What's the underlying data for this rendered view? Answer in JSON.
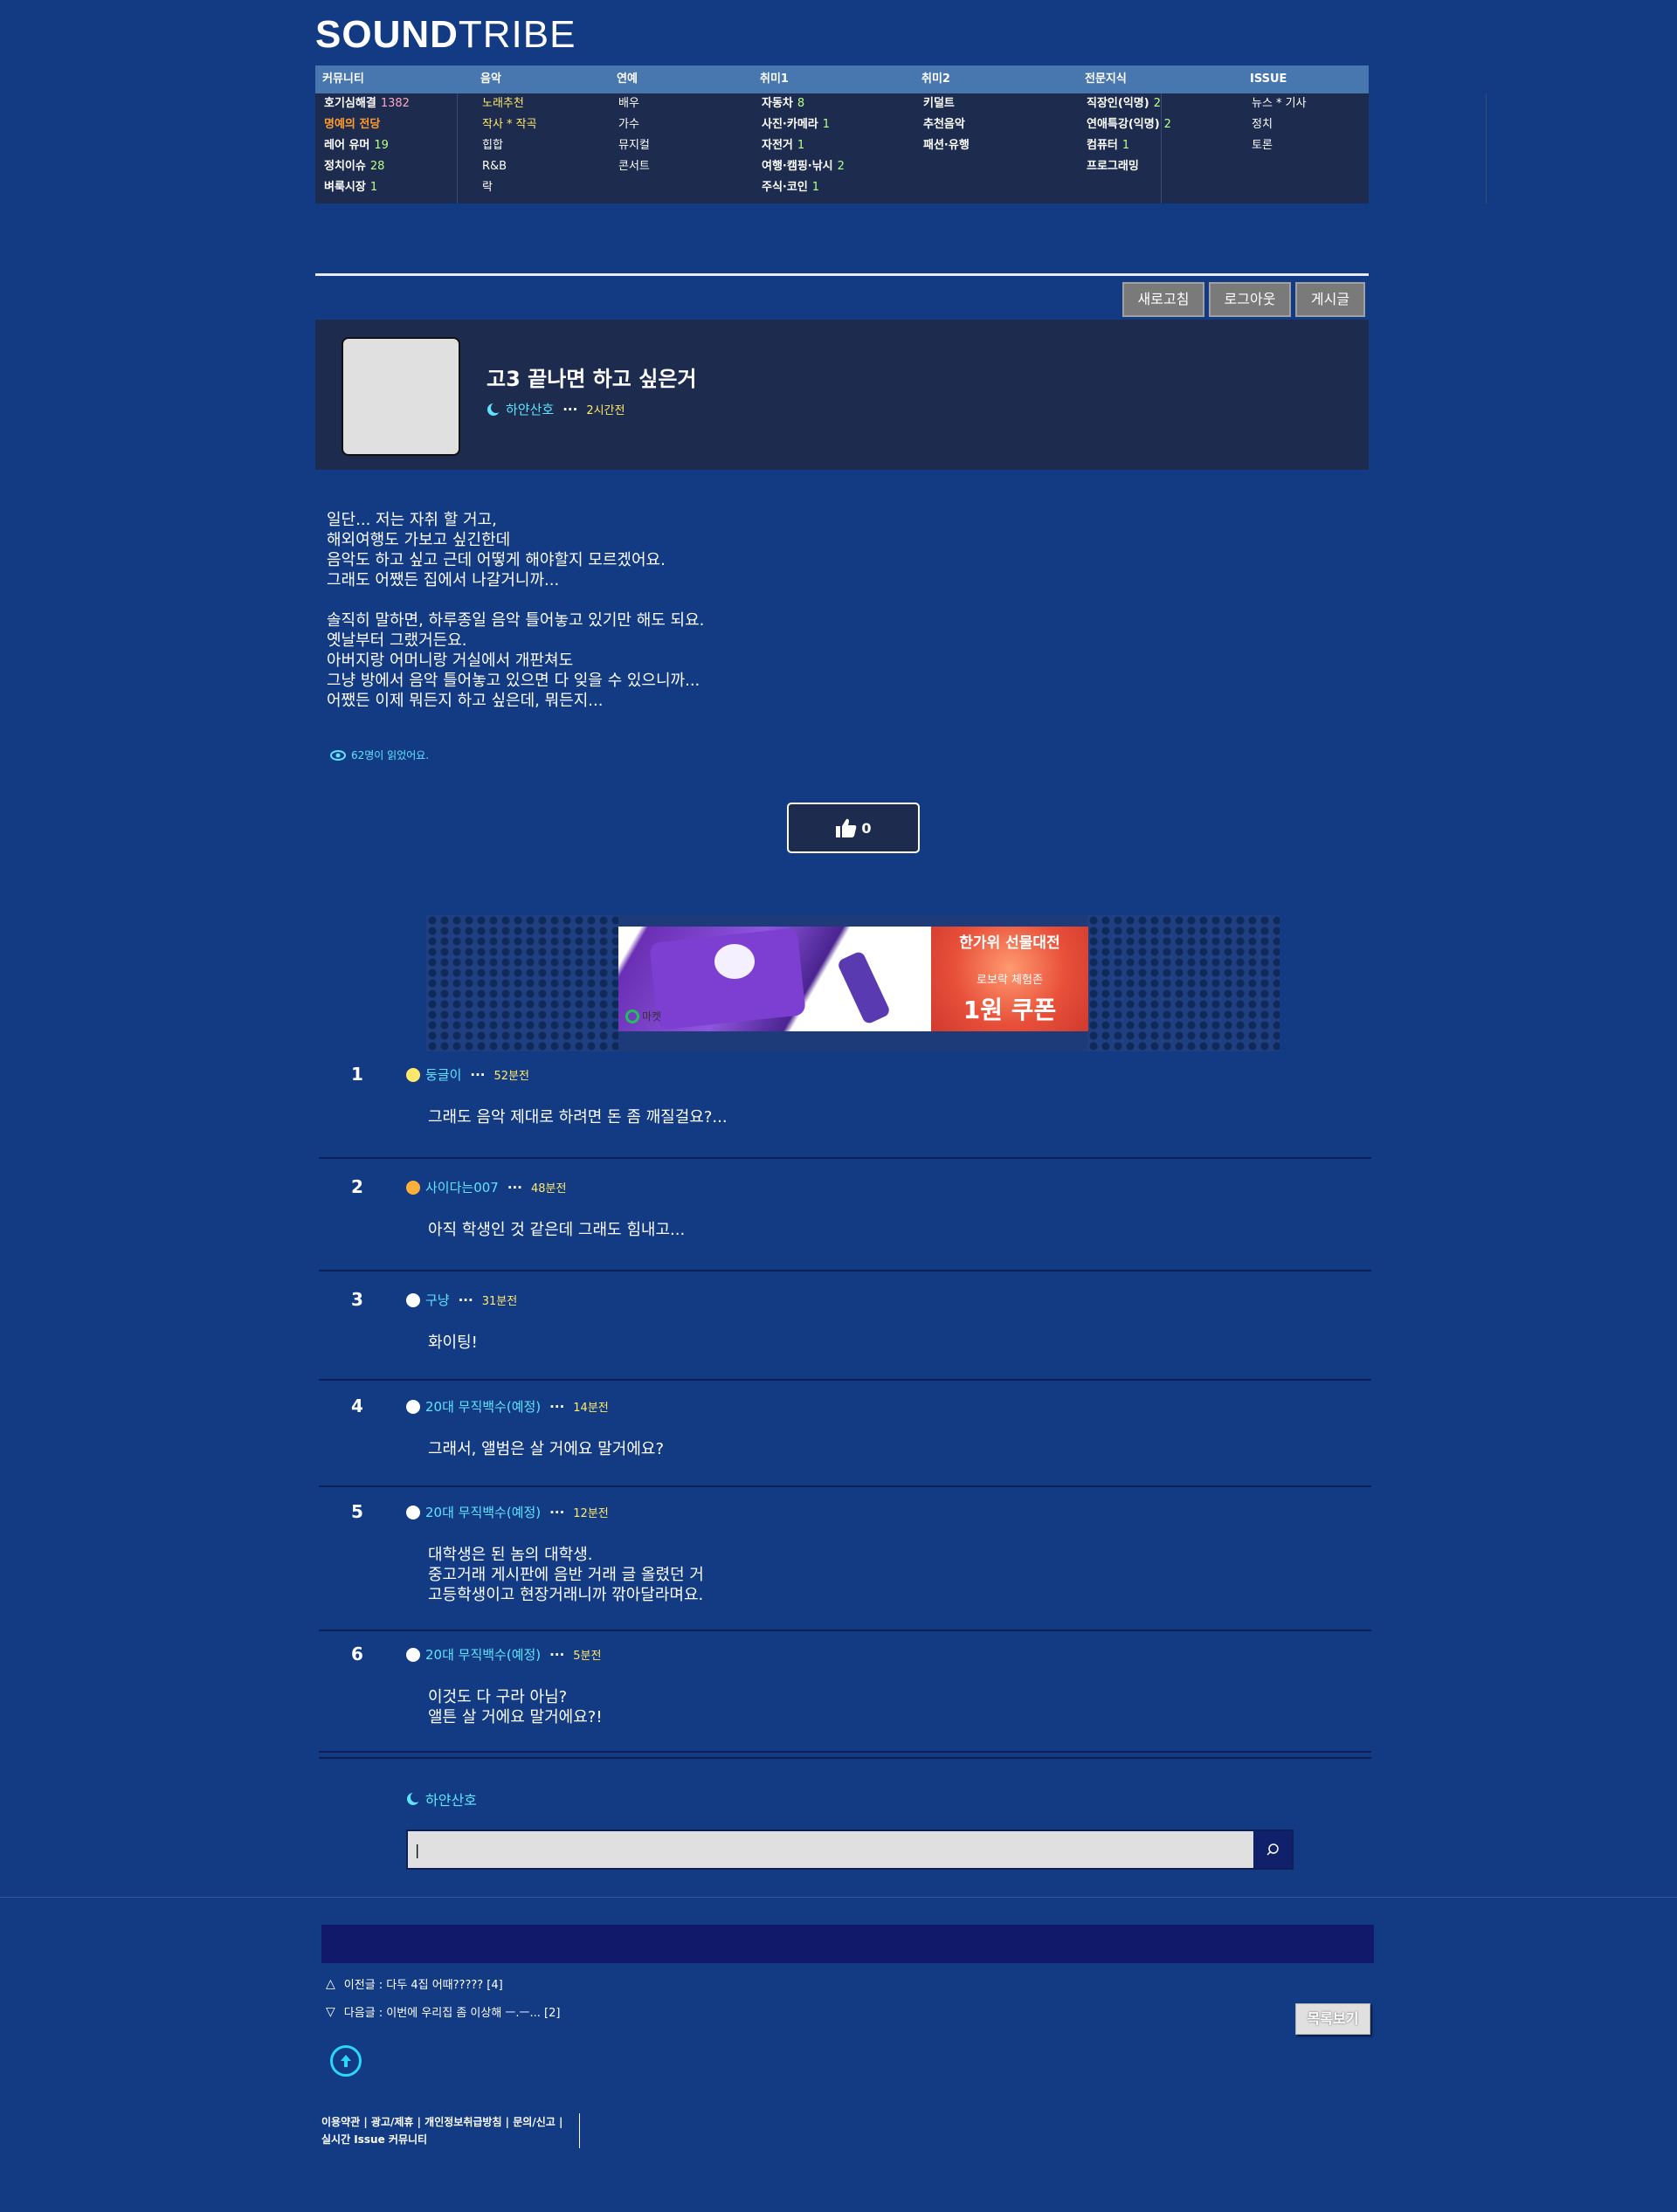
{
  "brand": {
    "bold": "SOUND",
    "light": "TRIBE"
  },
  "nav": {
    "columns": [
      {
        "title": "커뮤니티",
        "items": [
          {
            "label": "호기심해결",
            "count": "1382",
            "count_color": "pink"
          },
          {
            "label": "명예의 전당",
            "color": "orange"
          },
          {
            "label": "레어 유머",
            "count": "19"
          },
          {
            "label": "정치이슈",
            "count": "28"
          },
          {
            "label": "벼룩시장",
            "count": "1"
          }
        ]
      },
      {
        "title": "음악",
        "items": [
          {
            "label": "노래추천",
            "color": "yellow"
          },
          {
            "label": "작사 * 작곡",
            "color": "yellow"
          },
          {
            "label": "힙합"
          },
          {
            "label": "R&B"
          },
          {
            "label": "락"
          }
        ]
      },
      {
        "title": "연예",
        "items": [
          {
            "label": "배우"
          },
          {
            "label": "가수"
          },
          {
            "label": "뮤지컬"
          },
          {
            "label": "콘서트"
          }
        ]
      },
      {
        "title": "취미1",
        "items": [
          {
            "label": "자동차",
            "count": "8"
          },
          {
            "label": "사진·카메라",
            "count": "1"
          },
          {
            "label": "자전거",
            "count": "1"
          },
          {
            "label": "여행·캠핑·낚시",
            "count": "2"
          },
          {
            "label": "주식·코인",
            "count": "1"
          }
        ]
      },
      {
        "title": "취미2",
        "items": [
          {
            "label": "키덜트"
          },
          {
            "label": "추천음악"
          },
          {
            "label": "패션·유행"
          }
        ]
      },
      {
        "title": "전문지식",
        "items": [
          {
            "label": "직장인(익명)",
            "count": "2"
          },
          {
            "label": "연애특강(익명)",
            "count": "2"
          },
          {
            "label": "컴퓨터",
            "count": "1"
          },
          {
            "label": "프로그래밍"
          }
        ]
      },
      {
        "title": "ISSUE",
        "items": [
          {
            "label": "뉴스 * 기사"
          },
          {
            "label": "정치"
          },
          {
            "label": "토론"
          }
        ]
      }
    ]
  },
  "toolbar": {
    "refresh": "새로고침",
    "logout": "로그아웃",
    "posts": "게시글"
  },
  "post": {
    "title": "고3 끝나면 하고 싶은거",
    "author": "하얀산호",
    "dots": "···",
    "time": "2시간전",
    "body_p1": "일단... 저는 자취 할 거고,\n해외여행도 가보고 싶긴한데\n음악도 하고 싶고 근데 어떻게 해야할지 모르겠어요.\n그래도 어쨌든 집에서 나갈거니까...",
    "body_p2": "솔직히 말하면, 하루종일 음악 틀어놓고 있기만 해도 되요.\n옛날부터 그랬거든요.\n아버지랑 어머니랑 거실에서 개판쳐도\n그냥 방에서 음악 틀어놓고 있으면 다 잊을 수 있으니까...\n어쨌든 이제 뭐든지 하고 싶은데, 뭐든지...",
    "views": "62명이 읽었어요.",
    "likes": "0"
  },
  "ad": {
    "brand": "마켓",
    "headline": "한가위 선물대전",
    "sub": "로보락 체험존",
    "coupon": "1원 쿠폰"
  },
  "comments": [
    {
      "num": "1",
      "author": "둥글이",
      "dots": "···",
      "time": "52분전",
      "text": "그래도 음악 제대로 하려면 돈 좀 깨질걸요?..."
    },
    {
      "num": "2",
      "author": "사이다는007",
      "dots": "···",
      "time": "48분전",
      "text": "아직 학생인 것 같은데 그래도 힘내고..."
    },
    {
      "num": "3",
      "author": "구냥",
      "dots": "···",
      "time": "31분전",
      "text": "화이팅!"
    },
    {
      "num": "4",
      "author": "20대 무직백수(예정)",
      "dots": "···",
      "time": "14분전",
      "text": "그래서, 앨범은 살 거에요 말거에요?"
    },
    {
      "num": "5",
      "author": "20대 무직백수(예정)",
      "dots": "···",
      "time": "12분전",
      "text": "대학생은 된 놈의 대학생.\n중고거래 게시판에 음반 거래 글 올렸던 거\n고등학생이고 현장거래니까 깎아달라며요."
    },
    {
      "num": "6",
      "author": "20대 무직백수(예정)",
      "dots": "···",
      "time": "5분전",
      "text": "이것도 다 구라 아님?\n앨튼 살 거에요 말거에요?!"
    }
  ],
  "reply": {
    "user": "하얀산호",
    "value": "|"
  },
  "neighbors": {
    "prev": "이전글 : 다두 4집 어때????? [4]",
    "next": "다음글 : 이번에 우리집 좀 이상해 ㅡ.ㅡ... [2]"
  },
  "list_button": "목록보기",
  "footer": {
    "line1": "이용약관 | 광고/제휴 | 개인정보취급방침 | 문의/신고 |",
    "line2": "실시간 Issue 커뮤니티"
  },
  "colors": {
    "background": "#133b84",
    "panel": "#1d2b4e",
    "nav_header": "#4877b0",
    "accent_cyan": "#5fe4ff",
    "time_yellow": "#ffe96b"
  }
}
